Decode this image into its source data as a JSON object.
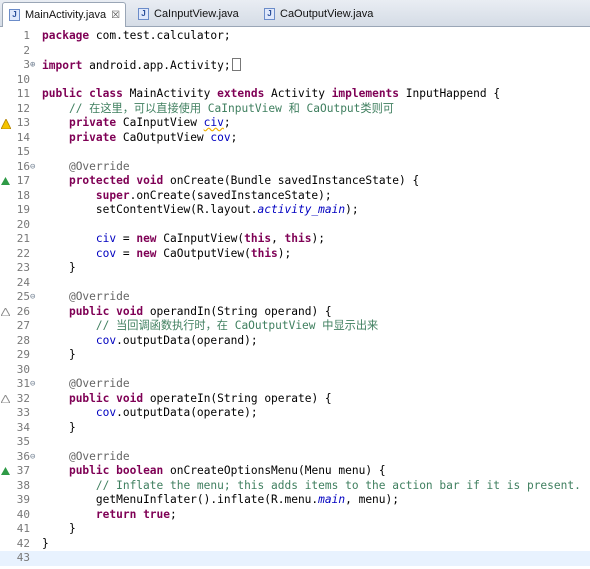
{
  "tabs": [
    {
      "label": "MainActivity.java",
      "close": "☒",
      "active": true
    },
    {
      "label": "CaInputView.java",
      "active": false
    },
    {
      "label": "CaOutputView.java",
      "active": false
    }
  ],
  "lines": [
    {
      "n": "1",
      "tokens": [
        {
          "c": "kw",
          "t": "package"
        },
        {
          "c": "",
          "t": " com.test.calculator;"
        }
      ]
    },
    {
      "n": "2",
      "tokens": []
    },
    {
      "n": "3",
      "fold": "⊕",
      "tokens": [
        {
          "c": "kw",
          "t": "import"
        },
        {
          "c": "",
          "t": " android.app.Activity;"
        }
      ],
      "box": true
    },
    {
      "n": "10",
      "tokens": []
    },
    {
      "n": "11",
      "tokens": [
        {
          "c": "kw",
          "t": "public"
        },
        {
          "c": "",
          "t": " "
        },
        {
          "c": "kw",
          "t": "class"
        },
        {
          "c": "",
          "t": " MainActivity "
        },
        {
          "c": "kw",
          "t": "extends"
        },
        {
          "c": "",
          "t": " Activity "
        },
        {
          "c": "kw",
          "t": "implements"
        },
        {
          "c": "",
          "t": " InputHappend {"
        }
      ]
    },
    {
      "n": "12",
      "tokens": [
        {
          "c": "",
          "t": "    "
        },
        {
          "c": "cm",
          "t": "// 在这里，可以直接使用 CaInputView 和 CaOutput类则可"
        }
      ]
    },
    {
      "n": "13",
      "marker": "warn",
      "tokens": [
        {
          "c": "",
          "t": "    "
        },
        {
          "c": "kw",
          "t": "private"
        },
        {
          "c": "",
          "t": " CaInputView "
        },
        {
          "c": "fd sq",
          "t": "civ"
        },
        {
          "c": "",
          "t": ";"
        }
      ]
    },
    {
      "n": "14",
      "tokens": [
        {
          "c": "",
          "t": "    "
        },
        {
          "c": "kw",
          "t": "private"
        },
        {
          "c": "",
          "t": " CaOutputView "
        },
        {
          "c": "fd",
          "t": "cov"
        },
        {
          "c": "",
          "t": ";"
        }
      ]
    },
    {
      "n": "15",
      "tokens": []
    },
    {
      "n": "16",
      "fold": "⊖",
      "tokens": [
        {
          "c": "",
          "t": "    "
        },
        {
          "c": "an",
          "t": "@Override"
        }
      ]
    },
    {
      "n": "17",
      "marker": "override",
      "tokens": [
        {
          "c": "",
          "t": "    "
        },
        {
          "c": "kw",
          "t": "protected"
        },
        {
          "c": "",
          "t": " "
        },
        {
          "c": "kw",
          "t": "void"
        },
        {
          "c": "",
          "t": " onCreate(Bundle savedInstanceState) {"
        }
      ]
    },
    {
      "n": "18",
      "tokens": [
        {
          "c": "",
          "t": "        "
        },
        {
          "c": "kw",
          "t": "super"
        },
        {
          "c": "",
          "t": ".onCreate(savedInstanceState);"
        }
      ]
    },
    {
      "n": "19",
      "tokens": [
        {
          "c": "",
          "t": "        setContentView(R.layout."
        },
        {
          "c": "st",
          "t": "activity_main"
        },
        {
          "c": "",
          "t": ");"
        }
      ]
    },
    {
      "n": "20",
      "tokens": []
    },
    {
      "n": "21",
      "tokens": [
        {
          "c": "",
          "t": "        "
        },
        {
          "c": "fd",
          "t": "civ"
        },
        {
          "c": "",
          "t": " = "
        },
        {
          "c": "kw",
          "t": "new"
        },
        {
          "c": "",
          "t": " CaInputView("
        },
        {
          "c": "kw",
          "t": "this"
        },
        {
          "c": "",
          "t": ", "
        },
        {
          "c": "kw",
          "t": "this"
        },
        {
          "c": "",
          "t": ");"
        }
      ]
    },
    {
      "n": "22",
      "tokens": [
        {
          "c": "",
          "t": "        "
        },
        {
          "c": "fd",
          "t": "cov"
        },
        {
          "c": "",
          "t": " = "
        },
        {
          "c": "kw",
          "t": "new"
        },
        {
          "c": "",
          "t": " CaOutputView("
        },
        {
          "c": "kw",
          "t": "this"
        },
        {
          "c": "",
          "t": ");"
        }
      ]
    },
    {
      "n": "23",
      "tokens": [
        {
          "c": "",
          "t": "    }"
        }
      ]
    },
    {
      "n": "24",
      "tokens": []
    },
    {
      "n": "25",
      "fold": "⊖",
      "tokens": [
        {
          "c": "",
          "t": "    "
        },
        {
          "c": "an",
          "t": "@Override"
        }
      ]
    },
    {
      "n": "26",
      "marker": "implement",
      "tokens": [
        {
          "c": "",
          "t": "    "
        },
        {
          "c": "kw",
          "t": "public"
        },
        {
          "c": "",
          "t": " "
        },
        {
          "c": "kw",
          "t": "void"
        },
        {
          "c": "",
          "t": " operandIn(String operand) {"
        }
      ]
    },
    {
      "n": "27",
      "tokens": [
        {
          "c": "",
          "t": "        "
        },
        {
          "c": "cm",
          "t": "// 当回调函数执行时，在 CaOutputView 中显示出来"
        }
      ]
    },
    {
      "n": "28",
      "tokens": [
        {
          "c": "",
          "t": "        "
        },
        {
          "c": "fd",
          "t": "cov"
        },
        {
          "c": "",
          "t": ".outputData(operand);"
        }
      ]
    },
    {
      "n": "29",
      "tokens": [
        {
          "c": "",
          "t": "    }"
        }
      ]
    },
    {
      "n": "30",
      "tokens": []
    },
    {
      "n": "31",
      "fold": "⊖",
      "tokens": [
        {
          "c": "",
          "t": "    "
        },
        {
          "c": "an",
          "t": "@Override"
        }
      ]
    },
    {
      "n": "32",
      "marker": "implement",
      "tokens": [
        {
          "c": "",
          "t": "    "
        },
        {
          "c": "kw",
          "t": "public"
        },
        {
          "c": "",
          "t": " "
        },
        {
          "c": "kw",
          "t": "void"
        },
        {
          "c": "",
          "t": " operateIn(String operate) {"
        }
      ]
    },
    {
      "n": "33",
      "tokens": [
        {
          "c": "",
          "t": "        "
        },
        {
          "c": "fd",
          "t": "cov"
        },
        {
          "c": "",
          "t": ".outputData(operate);"
        }
      ]
    },
    {
      "n": "34",
      "tokens": [
        {
          "c": "",
          "t": "    }"
        }
      ]
    },
    {
      "n": "35",
      "tokens": []
    },
    {
      "n": "36",
      "fold": "⊖",
      "tokens": [
        {
          "c": "",
          "t": "    "
        },
        {
          "c": "an",
          "t": "@Override"
        }
      ]
    },
    {
      "n": "37",
      "marker": "override",
      "tokens": [
        {
          "c": "",
          "t": "    "
        },
        {
          "c": "kw",
          "t": "public"
        },
        {
          "c": "",
          "t": " "
        },
        {
          "c": "kw",
          "t": "boolean"
        },
        {
          "c": "",
          "t": " onCreateOptionsMenu(Menu menu) {"
        }
      ]
    },
    {
      "n": "38",
      "tokens": [
        {
          "c": "",
          "t": "        "
        },
        {
          "c": "cm",
          "t": "// Inflate the menu; this adds items to the action bar if it is present."
        }
      ]
    },
    {
      "n": "39",
      "tokens": [
        {
          "c": "",
          "t": "        getMenuInflater().inflate(R.menu."
        },
        {
          "c": "st",
          "t": "main"
        },
        {
          "c": "",
          "t": ", menu);"
        }
      ]
    },
    {
      "n": "40",
      "tokens": [
        {
          "c": "",
          "t": "        "
        },
        {
          "c": "kw",
          "t": "return"
        },
        {
          "c": "",
          "t": " "
        },
        {
          "c": "kw",
          "t": "true"
        },
        {
          "c": "",
          "t": ";"
        }
      ]
    },
    {
      "n": "41",
      "tokens": [
        {
          "c": "",
          "t": "    }"
        }
      ]
    },
    {
      "n": "42",
      "tokens": [
        {
          "c": "",
          "t": "}"
        }
      ]
    },
    {
      "n": "43",
      "highlight": true,
      "tokens": []
    }
  ],
  "colors": {
    "keyword": "#7f0055",
    "comment": "#3f7f5f",
    "field": "#0000c0",
    "annotation": "#646464"
  }
}
